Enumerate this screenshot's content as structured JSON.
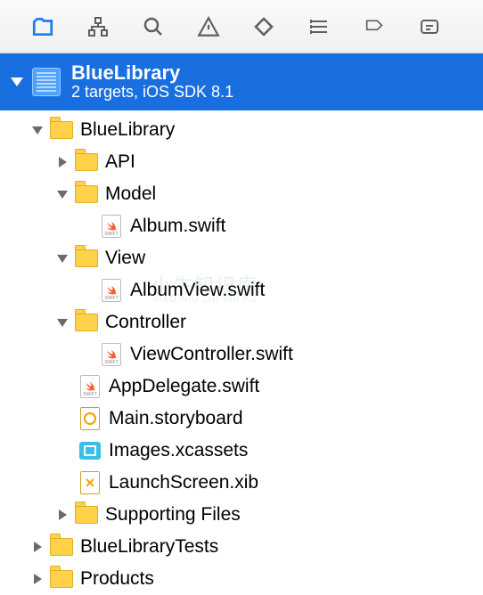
{
  "project": {
    "title": "BlueLibrary",
    "subtitle": "2 targets, iOS SDK 8.1"
  },
  "tree": {
    "root": "BlueLibrary",
    "api": "API",
    "model": "Model",
    "album_swift": "Album.swift",
    "view": "View",
    "albumview_swift": "AlbumView.swift",
    "controller": "Controller",
    "viewcontroller_swift": "ViewController.swift",
    "appdelegate_swift": "AppDelegate.swift",
    "main_storyboard": "Main.storyboard",
    "images_xcassets": "Images.xcassets",
    "launchscreen_xib": "LaunchScreen.xib",
    "supporting_files": "Supporting Files",
    "tests": "BlueLibraryTests",
    "products": "Products"
  },
  "watermark": {
    "cn": "小牛知识库",
    "en": "XIAO NIU ZHI SHI KU"
  }
}
